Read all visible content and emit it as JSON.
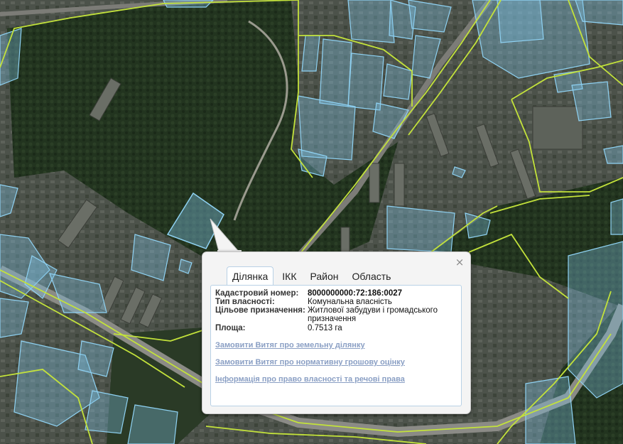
{
  "map": {
    "colors": {
      "forest": "#223520",
      "urban": "#4a5047",
      "parcel_fill": "#7fc3e6",
      "parcel_stroke": "#8fd2f3",
      "boundary": "#c3e23b",
      "road": "#8b8b86"
    }
  },
  "popup": {
    "close_icon": "×",
    "tabs": [
      {
        "label": "Ділянка",
        "active": true
      },
      {
        "label": "ІКК",
        "active": false
      },
      {
        "label": "Район",
        "active": false
      },
      {
        "label": "Область",
        "active": false
      }
    ],
    "fields": {
      "cadastral_label": "Кадастровий номер:",
      "cadastral_value": "8000000000:72:186:0027",
      "ownership_label": "Тип власності:",
      "ownership_value": "Комунальна власність",
      "purpose_label": "Цільове призначення:",
      "purpose_value": "Житлової забудуви і громадського призначення",
      "area_label": "Площа:",
      "area_value": "0.7513 га"
    },
    "links": {
      "extract_parcel": "Замовити Витяг про земельну ділянку",
      "extract_valuation": "Замовити Витяг про нормативну грошову оцінку",
      "ownership_info": "Інформація про право власності та речові права"
    }
  }
}
